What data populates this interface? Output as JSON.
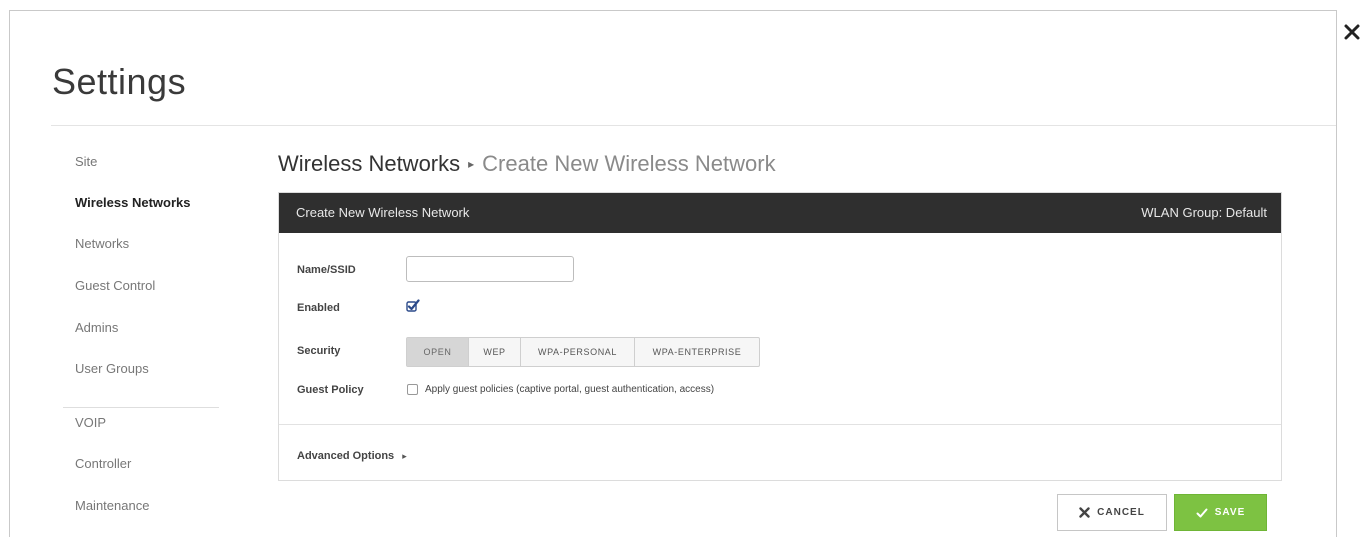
{
  "page": {
    "title": "Settings",
    "close_icon": "close-icon"
  },
  "sidebar": {
    "items": [
      {
        "label": "Site",
        "active": false
      },
      {
        "label": "Wireless Networks",
        "active": true
      },
      {
        "label": "Networks",
        "active": false
      },
      {
        "label": "Guest Control",
        "active": false
      },
      {
        "label": "Admins",
        "active": false
      },
      {
        "label": "User Groups",
        "active": false
      },
      {
        "label": "VOIP",
        "active": false
      },
      {
        "label": "Controller",
        "active": false
      },
      {
        "label": "Maintenance",
        "active": false
      }
    ]
  },
  "breadcrumb": {
    "section": "Wireless Networks",
    "separator": "▸",
    "page": "Create New Wireless Network"
  },
  "panel": {
    "header_title": "Create New Wireless Network",
    "header_group": "WLAN Group: Default",
    "form": {
      "name_label": "Name/SSID",
      "name_value": "",
      "enabled_label": "Enabled",
      "enabled_checked": true,
      "security_label": "Security",
      "security_options": [
        "OPEN",
        "WEP",
        "WPA-PERSONAL",
        "WPA-ENTERPRISE"
      ],
      "security_selected": "OPEN",
      "guest_label": "Guest Policy",
      "guest_checked": false,
      "guest_text": "Apply guest policies (captive portal, guest authentication, access)"
    },
    "advanced_label": "Advanced Options",
    "advanced_arrow": "▸"
  },
  "buttons": {
    "cancel": "CANCEL",
    "save": "SAVE"
  },
  "colors": {
    "header_bg": "#2f2f2f",
    "save_green": "#7dc242",
    "checkbox_blue": "#2b4a8a"
  }
}
